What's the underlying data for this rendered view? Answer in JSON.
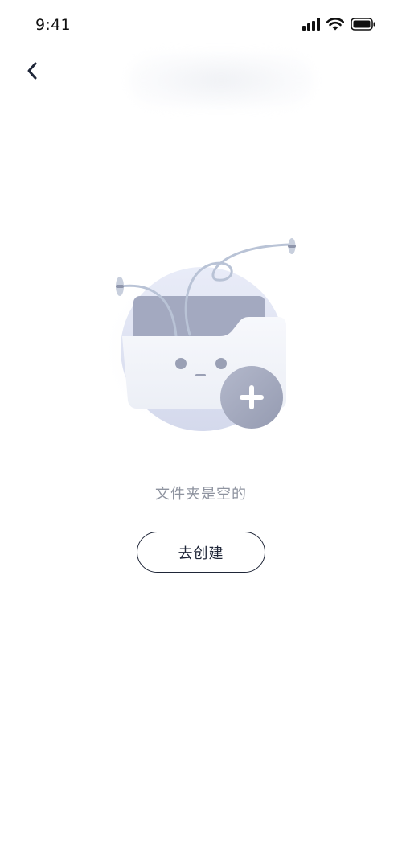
{
  "status_bar": {
    "time": "9:41",
    "icons": [
      "signal-icon",
      "wifi-icon",
      "battery-icon"
    ]
  },
  "nav": {
    "back_icon": "chevron-left-icon",
    "title": ""
  },
  "empty_state": {
    "illustration": "empty-folder-with-plus-icon",
    "message": "文件夹是空的",
    "action_label": "去创建"
  },
  "colors": {
    "primary_text": "#1f2638",
    "muted_text": "#8e939f",
    "illustration_accent": "#a4aabf",
    "illustration_light": "#dde2f1"
  }
}
